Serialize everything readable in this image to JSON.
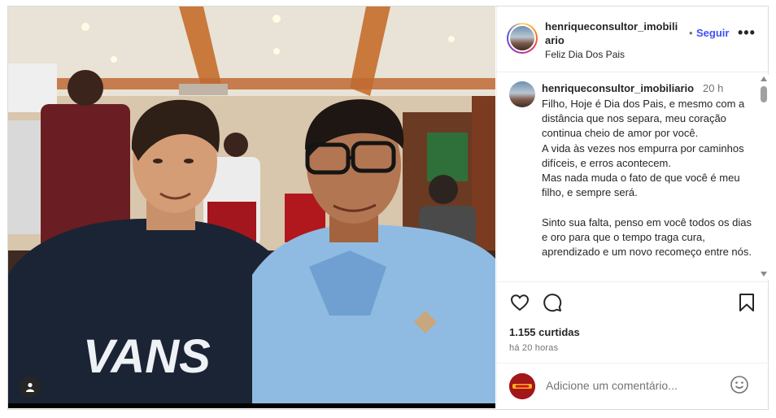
{
  "post": {
    "username_line1": "henriqueconsultor_imobili",
    "username_line2": "ario",
    "dot": "•",
    "follow_label": "Seguir",
    "more_label": "•••",
    "location": "Feliz Dia Dos Pais",
    "image_text": "VANS"
  },
  "caption": {
    "username": "henriqueconsultor_imobiliario",
    "time": "20 h",
    "text": "Filho, Hoje é Dia dos Pais, e mesmo com a distância que nos separa, meu coração continua cheio de amor por você.\nA vida às vezes nos empurra por caminhos difíceis, e erros acontecem.\nMas nada muda o fato de que você é meu filho, e sempre será.\n\nSinto sua falta, penso em você todos os dias e oro para que o tempo traga cura, aprendizado e um novo recomeço entre nós."
  },
  "actions": {
    "icons": [
      "heart-icon",
      "comment-icon",
      "bookmark-icon"
    ],
    "likes": "1.155 curtidas",
    "ago": "há 20 horas"
  },
  "comment": {
    "placeholder": "Adicione um comentário..."
  },
  "colors": {
    "accent": "#4150f7",
    "muted": "#737373",
    "border": "#dbdbdb"
  }
}
